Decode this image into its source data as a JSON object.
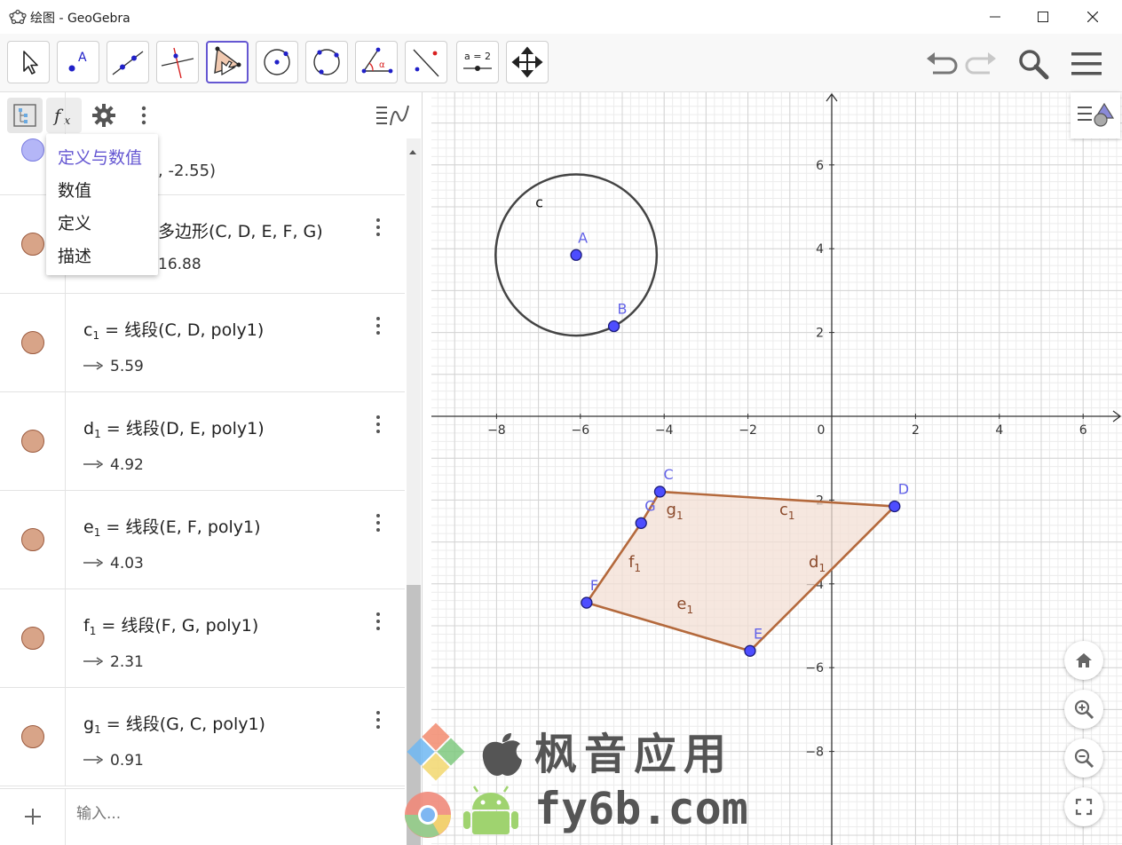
{
  "window": {
    "title": "绘图 - GeoGebra"
  },
  "toolbar": {
    "tools": [
      {
        "name": "move-tool",
        "icon": "cursor-arrow-icon"
      },
      {
        "name": "point-tool",
        "icon": "point-A-icon",
        "label": "A"
      },
      {
        "name": "line-tool",
        "icon": "line-through-points-icon"
      },
      {
        "name": "perpendicular-line-tool",
        "icon": "perpendicular-line-icon"
      },
      {
        "name": "polygon-tool",
        "icon": "polygon-icon"
      },
      {
        "name": "circle-tool",
        "icon": "circle-center-point-icon"
      },
      {
        "name": "circle-three-points-tool",
        "icon": "circle-three-points-icon"
      },
      {
        "name": "angle-tool",
        "icon": "angle-icon",
        "label": "α"
      },
      {
        "name": "reflect-tool",
        "icon": "reflect-about-line-icon"
      },
      {
        "name": "slider-tool",
        "icon": "slider-icon",
        "label": "a = 2"
      },
      {
        "name": "move-graphics-tool",
        "icon": "move-arrows-icon"
      }
    ],
    "active_tool_index": 4
  },
  "algebra": {
    "menu": {
      "items": [
        "定义与数值",
        "数值",
        "定义",
        "描述"
      ],
      "selected_index": 0
    },
    "rows": [
      {
        "value_text": ", -2.55)",
        "color": "#b4b6f7"
      },
      {
        "def_text": "多边形(C, D, E, F, G)",
        "value_text": "16.88",
        "color": "#d8a488"
      },
      {
        "name": "c",
        "sub": "1",
        "def_text": "线段(C, D, poly1)",
        "value": "5.59",
        "color": "#d8a488"
      },
      {
        "name": "d",
        "sub": "1",
        "def_text": "线段(D, E, poly1)",
        "value": "4.92",
        "color": "#d8a488"
      },
      {
        "name": "e",
        "sub": "1",
        "def_text": "线段(E, F, poly1)",
        "value": "4.03",
        "color": "#d8a488"
      },
      {
        "name": "f",
        "sub": "1",
        "def_text": "线段(F, G, poly1)",
        "value": "2.31",
        "color": "#d8a488"
      },
      {
        "name": "g",
        "sub": "1",
        "def_text": "线段(G, C, poly1)",
        "value": "0.91",
        "color": "#d8a488"
      }
    ],
    "input_placeholder": "输入..."
  },
  "graphics": {
    "axes": {
      "x_ticks": [
        "−8",
        "−6",
        "−4",
        "−2",
        "0",
        "2",
        "4",
        "6"
      ],
      "y_ticks": [
        "6",
        "4",
        "2",
        "−2",
        "−4",
        "−6",
        "−8"
      ],
      "xlim": [
        -9.4,
        7
      ],
      "ylim": [
        -10,
        7.5
      ]
    },
    "points": [
      {
        "label": "A",
        "x": -6.1,
        "y": 3.85
      },
      {
        "label": "B",
        "x": -5.2,
        "y": 2.15
      },
      {
        "label": "C",
        "x": -4.1,
        "y": -1.8
      },
      {
        "label": "D",
        "x": 1.5,
        "y": -2.15
      },
      {
        "label": "E",
        "x": -1.95,
        "y": -5.6
      },
      {
        "label": "F",
        "x": -5.85,
        "y": -4.45
      },
      {
        "label": "G",
        "x": -4.55,
        "y": -2.55
      }
    ],
    "circle": {
      "label": "c",
      "center": "A",
      "through": "B"
    },
    "segment_labels": [
      {
        "name": "g",
        "sub": "1",
        "x": -3.95,
        "y": -2.35
      },
      {
        "name": "c",
        "sub": "1",
        "x": -1.25,
        "y": -2.35
      },
      {
        "name": "d",
        "sub": "1",
        "x": -0.55,
        "y": -3.6
      },
      {
        "name": "f",
        "sub": "1",
        "x": -4.85,
        "y": -3.6
      },
      {
        "name": "e",
        "sub": "1",
        "x": -3.7,
        "y": -4.6
      }
    ],
    "colors": {
      "polygon_stroke": "#b4693c",
      "polygon_fill": "#f3dfd4",
      "point": "#4d4dff",
      "circle": "#444444",
      "label_blue": "#6262e8",
      "label_brown": "#8b4a2b"
    }
  },
  "watermark": {
    "cn": "枫音应用",
    "url": "fy6b.com"
  }
}
